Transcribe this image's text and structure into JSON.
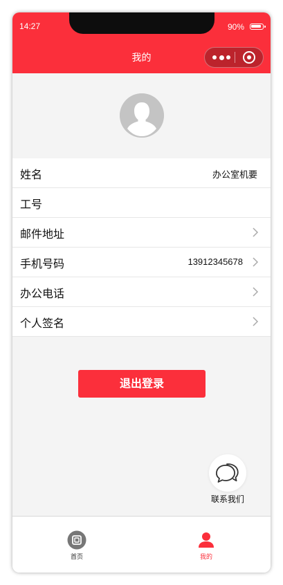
{
  "status_bar": {
    "time": "14:27",
    "battery": "90%"
  },
  "navbar": {
    "title": "我的"
  },
  "profile": {
    "avatar_icon": "default-avatar-icon"
  },
  "fields": [
    {
      "label": "姓名",
      "value": "办公室机要",
      "has_arrow": false
    },
    {
      "label": "工号",
      "value": "",
      "has_arrow": false
    },
    {
      "label": "邮件地址",
      "value": "",
      "has_arrow": true
    },
    {
      "label": "手机号码",
      "value": "13912345678",
      "has_arrow": true
    },
    {
      "label": "办公电话",
      "value": "",
      "has_arrow": true
    },
    {
      "label": "个人签名",
      "value": "",
      "has_arrow": true
    }
  ],
  "actions": {
    "logout_label": "退出登录",
    "contact_label": "联系我们"
  },
  "tabbar": {
    "home_label": "首页",
    "mine_label": "我的"
  },
  "colors": {
    "brand_red": "#fb2f3b",
    "background": "#f4f4f4",
    "avatar_gray": "#c4c4c4"
  }
}
